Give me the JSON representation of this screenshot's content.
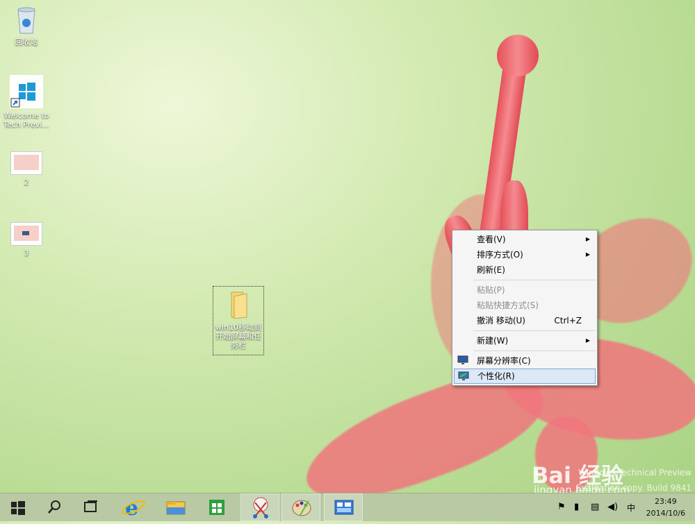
{
  "desktop": {
    "icons": [
      {
        "label": "回收站",
        "icon": "recycle-bin-icon"
      },
      {
        "label": "Welcome to\nTech Previ...",
        "icon": "windows-logo-icon"
      },
      {
        "label": "2",
        "icon": "image-thumbnail-icon"
      },
      {
        "label": "3",
        "icon": "image-thumbnail-icon"
      },
      {
        "label": "win10移动到\n开始屏幕和任\n务栏",
        "icon": "folder-icon"
      }
    ]
  },
  "context_menu": {
    "items": [
      {
        "label": "查看(V)",
        "submenu": true
      },
      {
        "label": "排序方式(O)",
        "submenu": true
      },
      {
        "label": "刷新(E)"
      },
      {
        "label": "粘贴(P)",
        "disabled": true
      },
      {
        "label": "粘贴快捷方式(S)",
        "disabled": true
      },
      {
        "label": "撤消 移动(U)",
        "shortcut": "Ctrl+Z"
      },
      {
        "label": "新建(W)",
        "submenu": true
      },
      {
        "label": "屏幕分辨率(C)",
        "icon": "monitor-icon"
      },
      {
        "label": "个性化(R)",
        "icon": "personalize-icon",
        "highlighted": true
      }
    ]
  },
  "taskbar": {
    "buttons": [
      "start-icon",
      "search-icon",
      "task-view-icon",
      "ie-icon",
      "file-explorer-icon",
      "store-icon",
      "snipping-tool-icon",
      "paint-icon",
      "control-panel-icon"
    ],
    "tray": {
      "ime": "中",
      "time": "23:49",
      "date": "2014/10/6"
    }
  },
  "watermark": {
    "line1": "Windows Technical Preview",
    "line2": "Evaluation copy. Build 9841",
    "brand": "Bai 经验",
    "url": "jingyan.baidu.com"
  },
  "colors": {
    "accent": "#dce8f5",
    "taskbar": "#b8c9a3",
    "flower": "#f0767d"
  }
}
